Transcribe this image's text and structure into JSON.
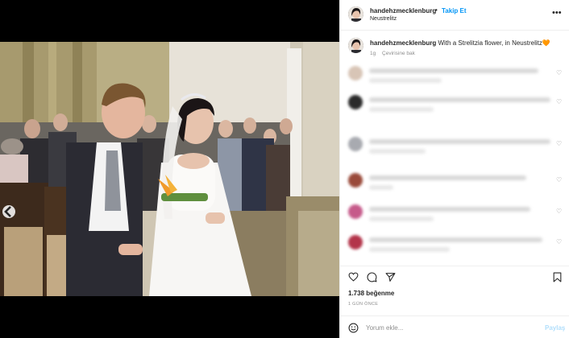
{
  "header": {
    "username": "handehzmecklenburg",
    "separator": "•",
    "follow_label": "Takip Et",
    "location": "Neustrelitz",
    "more_glyph": "•••"
  },
  "caption": {
    "username": "handehzmecklenburg",
    "text": "With a Strelitzia flower, in Neustrelitz",
    "emoji": "🧡",
    "age": "1g",
    "translate_label": "Çevirisine bak"
  },
  "comments": {
    "count_visible": 8,
    "note_blurred": true
  },
  "actions": {
    "like_icon": "heart-icon",
    "comment_icon": "comment-icon",
    "share_icon": "share-icon",
    "save_icon": "bookmark-icon"
  },
  "stats": {
    "likes": "1.738 beğenme",
    "time_ago": "1 GÜN ÖNCE"
  },
  "composer": {
    "placeholder": "Yorum ekle...",
    "post_label": "Paylaş"
  },
  "colors": {
    "accent": "#0095f6",
    "post_disabled": "#b2dffc",
    "muted": "#8e8e8e"
  }
}
